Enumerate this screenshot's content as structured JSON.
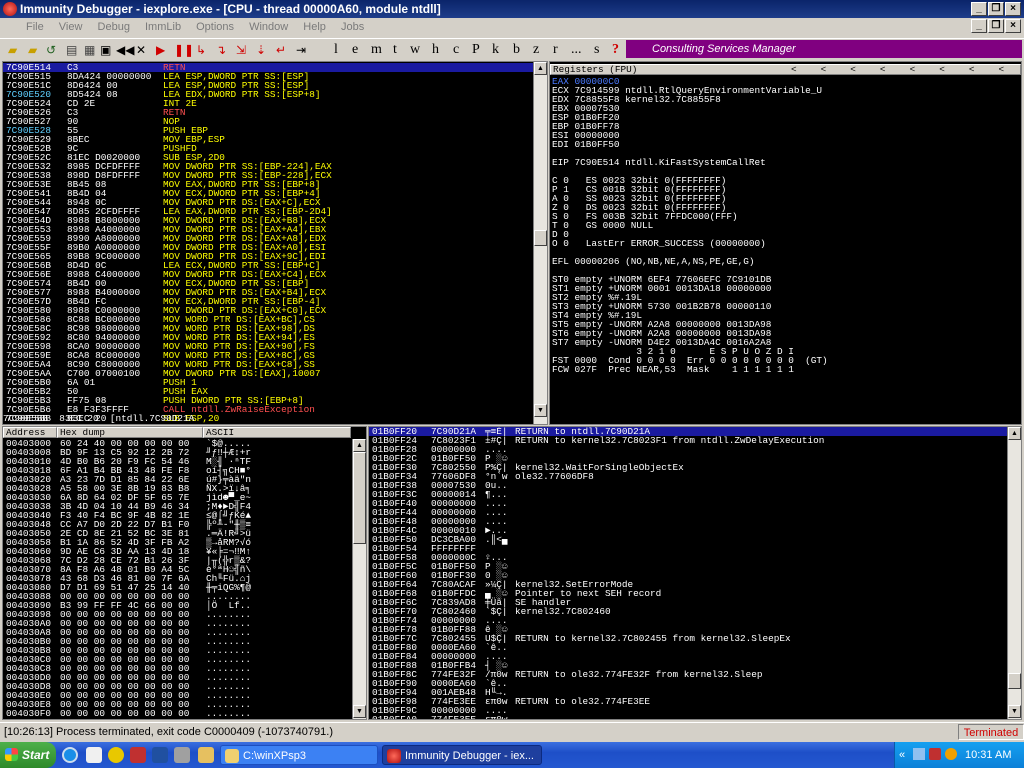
{
  "window": {
    "title": "Immunity Debugger - iexplore.exe - [CPU - thread 00000A60, module ntdll]"
  },
  "menu": [
    "File",
    "View",
    "Debug",
    "ImmLib",
    "Options",
    "Window",
    "Help",
    "Jobs"
  ],
  "toolbar": {
    "letters": [
      "l",
      "e",
      "m",
      "t",
      "w",
      "h",
      "c",
      "P",
      "k",
      "b",
      "z",
      "r",
      "...",
      "s",
      "?"
    ],
    "banner": "Consulting Services Manager"
  },
  "disasm": [
    {
      "a": "7C90E514",
      "h": "C3",
      "i": "RETN",
      "c": "#ff5050"
    },
    {
      "a": "7C90E515",
      "h": "8DA424 00000000",
      "i": "LEA ESP,DWORD PTR SS:[ESP]",
      "c": "#ffff00"
    },
    {
      "a": "7C90E51C",
      "h": "8D6424 00",
      "i": "LEA ESP,DWORD PTR SS:[ESP]",
      "c": "#ffff00"
    },
    {
      "a": "7C90E520",
      "h": "8D5424 08",
      "i": "LEA EDX,DWORD PTR SS:[ESP+8]",
      "c": "#ffff00"
    },
    {
      "a": "7C90E524",
      "h": "CD 2E",
      "i": "INT 2E",
      "c": "#ffff00"
    },
    {
      "a": "7C90E526",
      "h": "C3",
      "i": "RETN",
      "c": "#ff5050"
    },
    {
      "a": "7C90E527",
      "h": "90",
      "i": "NOP",
      "c": "#ffff00"
    },
    {
      "a": "7C90E528",
      "h": "55",
      "i": "PUSH EBP",
      "c": "#ffff00"
    },
    {
      "a": "7C90E529",
      "h": "8BEC",
      "i": "MOV EBP,ESP",
      "c": "#ffff00"
    },
    {
      "a": "7C90E52B",
      "h": "9C",
      "i": "PUSHFD",
      "c": "#ffff00"
    },
    {
      "a": "7C90E52C",
      "h": "81EC D0020000",
      "i": "SUB ESP,2D0",
      "c": "#ffff00"
    },
    {
      "a": "7C90E532",
      "h": "8985 DCFDFFFF",
      "i": "MOV DWORD PTR SS:[EBP-224],EAX",
      "c": "#ffff00"
    },
    {
      "a": "7C90E538",
      "h": "898D D8FDFFFF",
      "i": "MOV DWORD PTR SS:[EBP-228],ECX",
      "c": "#ffff00"
    },
    {
      "a": "7C90E53E",
      "h": "8B45 08",
      "i": "MOV EAX,DWORD PTR SS:[EBP+8]",
      "c": "#ffff00"
    },
    {
      "a": "7C90E541",
      "h": "8B4D 04",
      "i": "MOV ECX,DWORD PTR SS:[EBP+4]",
      "c": "#ffff00"
    },
    {
      "a": "7C90E544",
      "h": "8948 0C",
      "i": "MOV DWORD PTR DS:[EAX+C],ECX",
      "c": "#ffff00"
    },
    {
      "a": "7C90E547",
      "h": "8D85 2CFDFFFF",
      "i": "LEA EAX,DWORD PTR SS:[EBP-2D4]",
      "c": "#ffff00"
    },
    {
      "a": "7C90E54D",
      "h": "8988 B8000000",
      "i": "MOV DWORD PTR DS:[EAX+B8],ECX",
      "c": "#ffff00"
    },
    {
      "a": "7C90E553",
      "h": "8998 A4000000",
      "i": "MOV DWORD PTR DS:[EAX+A4],EBX",
      "c": "#ffff00"
    },
    {
      "a": "7C90E559",
      "h": "8990 A8000000",
      "i": "MOV DWORD PTR DS:[EAX+A8],EDX",
      "c": "#ffff00"
    },
    {
      "a": "7C90E55F",
      "h": "89B0 A0000000",
      "i": "MOV DWORD PTR DS:[EAX+A0],ESI",
      "c": "#ffff00"
    },
    {
      "a": "7C90E565",
      "h": "89B8 9C000000",
      "i": "MOV DWORD PTR DS:[EAX+9C],EDI",
      "c": "#ffff00"
    },
    {
      "a": "7C90E56B",
      "h": "8D4D 0C",
      "i": "LEA ECX,DWORD PTR SS:[EBP+C]",
      "c": "#ffff00"
    },
    {
      "a": "7C90E56E",
      "h": "8988 C4000000",
      "i": "MOV DWORD PTR DS:[EAX+C4],ECX",
      "c": "#ffff00"
    },
    {
      "a": "7C90E574",
      "h": "8B4D 00",
      "i": "MOV ECX,DWORD PTR SS:[EBP]",
      "c": "#ffff00"
    },
    {
      "a": "7C90E577",
      "h": "8988 B4000000",
      "i": "MOV DWORD PTR DS:[EAX+B4],ECX",
      "c": "#ffff00"
    },
    {
      "a": "7C90E57D",
      "h": "8B4D FC",
      "i": "MOV ECX,DWORD PTR SS:[EBP-4]",
      "c": "#ffff00"
    },
    {
      "a": "7C90E580",
      "h": "8988 C0000000",
      "i": "MOV DWORD PTR DS:[EAX+C0],ECX",
      "c": "#ffff00"
    },
    {
      "a": "7C90E586",
      "h": "8C88 BC000000",
      "i": "MOV WORD PTR DS:[EAX+BC],CS",
      "c": "#ffff00"
    },
    {
      "a": "7C90E58C",
      "h": "8C98 98000000",
      "i": "MOV WORD PTR DS:[EAX+98],DS",
      "c": "#ffff00"
    },
    {
      "a": "7C90E592",
      "h": "8C80 94000000",
      "i": "MOV WORD PTR DS:[EAX+94],ES",
      "c": "#ffff00"
    },
    {
      "a": "7C90E598",
      "h": "8CA0 90000000",
      "i": "MOV WORD PTR DS:[EAX+90],FS",
      "c": "#ffff00"
    },
    {
      "a": "7C90E59E",
      "h": "8CA8 8C000000",
      "i": "MOV WORD PTR DS:[EAX+8C],GS",
      "c": "#ffff00"
    },
    {
      "a": "7C90E5A4",
      "h": "8C90 C8000000",
      "i": "MOV WORD PTR DS:[EAX+C8],SS",
      "c": "#ffff00"
    },
    {
      "a": "7C90E5AA",
      "h": "C700 07000100",
      "i": "MOV DWORD PTR DS:[EAX],10007",
      "c": "#ffff00"
    },
    {
      "a": "7C90E5B0",
      "h": "6A 01",
      "i": "PUSH 1",
      "c": "#ffff00"
    },
    {
      "a": "7C90E5B2",
      "h": "50",
      "i": "PUSH EAX",
      "c": "#ffff00"
    },
    {
      "a": "7C90E5B3",
      "h": "FF75 08",
      "i": "PUSH DWORD PTR SS:[EBP+8]",
      "c": "#ffff00"
    },
    {
      "a": "7C90E5B6",
      "h": "E8 F3F3FFFF",
      "i": "CALL ntdll.ZwRaiseException",
      "c": "#ff5050"
    },
    {
      "a": "7C90E5BB",
      "h": "83EC 20",
      "i": "SUB ESP,20",
      "c": "#ffff00"
    }
  ],
  "info_line": "7C90E5BB  83EC 20  [ntdll.7C90D21A",
  "registers": {
    "header": "Registers (FPU)",
    "header_arrows": [
      "<",
      "<",
      "<",
      "<",
      "<",
      "<",
      "<",
      "<"
    ],
    "lines": [
      {
        "t": "EAX 000000C0",
        "c": "#4a7aff"
      },
      {
        "t": "ECX 7C914599 ntdll.RtlQueryEnvironmentVariable_U",
        "c": "#ffffff"
      },
      {
        "t": "EDX 7C8855F8 kernel32.7C8855F8",
        "c": "#ffffff"
      },
      {
        "t": "EBX 00007530",
        "c": "#ffffff"
      },
      {
        "t": "ESP 01B0FF20",
        "c": "#ffffff"
      },
      {
        "t": "EBP 01B0FF78",
        "c": "#ffffff"
      },
      {
        "t": "ESI 00000000",
        "c": "#ffffff"
      },
      {
        "t": "EDI 01B0FF50",
        "c": "#ffffff"
      },
      {
        "t": "",
        "c": "#ffffff"
      },
      {
        "t": "EIP 7C90E514 ntdll.KiFastSystemCallRet",
        "c": "#ffffff"
      },
      {
        "t": "",
        "c": "#ffffff"
      },
      {
        "t": "C 0   ES 0023 32bit 0(FFFFFFFF)",
        "c": "#ffffff"
      },
      {
        "t": "P 1   CS 001B 32bit 0(FFFFFFFF)",
        "c": "#ffffff"
      },
      {
        "t": "A 0   SS 0023 32bit 0(FFFFFFFF)",
        "c": "#ffffff"
      },
      {
        "t": "Z 0   DS 0023 32bit 0(FFFFFFFF)",
        "c": "#ffffff"
      },
      {
        "t": "S 0   FS 003B 32bit 7FFDC000(FFF)",
        "c": "#ffffff"
      },
      {
        "t": "T 0   GS 0000 NULL",
        "c": "#ffffff"
      },
      {
        "t": "D 0",
        "c": "#ffffff"
      },
      {
        "t": "O 0   LastErr ERROR_SUCCESS (00000000)",
        "c": "#ffffff"
      },
      {
        "t": "",
        "c": "#ffffff"
      },
      {
        "t": "EFL 00000206 (NO,NB,NE,A,NS,PE,GE,G)",
        "c": "#ffffff"
      },
      {
        "t": "",
        "c": "#ffffff"
      },
      {
        "t": "ST0 empty +UNORM 6EF4 77606EFC 7C9101DB",
        "c": "#ffffff"
      },
      {
        "t": "ST1 empty +UNORM 0001 0013DA18 00000000",
        "c": "#ffffff"
      },
      {
        "t": "ST2 empty %#.19L",
        "c": "#ffffff"
      },
      {
        "t": "ST3 empty +UNORM 5730 001B2B78 00000110",
        "c": "#ffffff"
      },
      {
        "t": "ST4 empty %#.19L",
        "c": "#ffffff"
      },
      {
        "t": "ST5 empty -UNORM A2A8 00000000 0013DA98",
        "c": "#ffffff"
      },
      {
        "t": "ST6 empty -UNORM A2A8 00000000 0013DA98",
        "c": "#ffffff"
      },
      {
        "t": "ST7 empty -UNORM D4E2 0013DA4C 0016A2A8",
        "c": "#ffffff"
      },
      {
        "t": "               3 2 1 0      E S P U O Z D I",
        "c": "#ffffff"
      },
      {
        "t": "FST 0000  Cond 0 0 0 0  Err 0 0 0 0 0 0 0 0  (GT)",
        "c": "#ffffff"
      },
      {
        "t": "FCW 027F  Prec NEAR,53  Mask    1 1 1 1 1 1",
        "c": "#ffffff"
      }
    ]
  },
  "hexdump": {
    "headers": [
      "Address",
      "Hex dump",
      "ASCII"
    ],
    "rows": [
      {
        "a": "00403000",
        "h": "60 24 40 00 00 00 00 00",
        "s": "`$@....."
      },
      {
        "a": "00403008",
        "h": "BD 9F 13 C5 92 12 2B 72",
        "s": "╜ƒ‼┼Æ↕+r"
      },
      {
        "a": "00403010",
        "h": "4D B0 B6 20 F9 FC 54 46",
        "s": "M░╢ ∙ⁿTF"
      },
      {
        "a": "00403018",
        "h": "6F A1 B4 BB 43 48 FE F8",
        "s": "oí┤╗CH■°"
      },
      {
        "a": "00403020",
        "h": "A3 23 7D D1 85 84 22 6E",
        "s": "ú#}╤àä\"n"
      },
      {
        "a": "00403028",
        "h": "A5 58 00 3E 8B 19 83 B8",
        "s": "ÑX.>ï↓â╕"
      },
      {
        "a": "00403030",
        "h": "6A 8D 64 02 DF 5F 65 7E",
        "s": "jìd☻▀_e~"
      },
      {
        "a": "00403038",
        "h": "3B 4D 04 10 44 B9 46 34",
        "s": ";M♦►D╣F4"
      },
      {
        "a": "00403040",
        "h": "F3 40 F4 BC 9F 4B 82 1E",
        "s": "≤@⌠╝ƒKé▲"
      },
      {
        "a": "00403048",
        "h": "CC A7 D0 2D 22 D7 B1 F0",
        "s": "╠º╨-\"╫▒≡"
      },
      {
        "a": "00403050",
        "h": "2E CD 8E 21 52 BC 3E 81",
        "s": ".═Ä!R╝>ü"
      },
      {
        "a": "00403058",
        "h": "B1 1A 86 52 4D 3F FB A2",
        "s": "▒→åRM?√ó"
      },
      {
        "a": "00403060",
        "h": "9D AE C6 3D AA 13 4D 18",
        "s": "¥«╞=¬‼M↑"
      },
      {
        "a": "00403068",
        "h": "7C D2 28 CE 72 B1 26 3F",
        "s": "|╥(╬r▒&?"
      },
      {
        "a": "00403070",
        "h": "8A F8 A6 48 01 B9 A4 5C",
        "s": "è°ªH☺╣ñ\\"
      },
      {
        "a": "00403078",
        "h": "43 68 D3 46 81 00 7F 6A",
        "s": "Ch╙Fü.⌂j"
      },
      {
        "a": "00403080",
        "h": "D7 D1 69 51 47 25 14 40",
        "s": "╫╤iQG%¶@"
      },
      {
        "a": "00403088",
        "h": "00 00 00 00 00 00 00 00",
        "s": "........"
      },
      {
        "a": "00403090",
        "h": "B3 99 FF FF 4C 66 00 00",
        "s": "│Ö  Lf.."
      },
      {
        "a": "00403098",
        "h": "00 00 00 00 00 00 00 00",
        "s": "........"
      },
      {
        "a": "004030A0",
        "h": "00 00 00 00 00 00 00 00",
        "s": "........"
      },
      {
        "a": "004030A8",
        "h": "00 00 00 00 00 00 00 00",
        "s": "........"
      },
      {
        "a": "004030B0",
        "h": "00 00 00 00 00 00 00 00",
        "s": "........"
      },
      {
        "a": "004030B8",
        "h": "00 00 00 00 00 00 00 00",
        "s": "........"
      },
      {
        "a": "004030C0",
        "h": "00 00 00 00 00 00 00 00",
        "s": "........"
      },
      {
        "a": "004030C8",
        "h": "00 00 00 00 00 00 00 00",
        "s": "........"
      },
      {
        "a": "004030D0",
        "h": "00 00 00 00 00 00 00 00",
        "s": "........"
      },
      {
        "a": "004030D8",
        "h": "00 00 00 00 00 00 00 00",
        "s": "........"
      },
      {
        "a": "004030E0",
        "h": "00 00 00 00 00 00 00 00",
        "s": "........"
      },
      {
        "a": "004030E8",
        "h": "00 00 00 00 00 00 00 00",
        "s": "........"
      },
      {
        "a": "004030F0",
        "h": "00 00 00 00 00 00 00 00",
        "s": "........"
      }
    ]
  },
  "stack": [
    {
      "a": "01B0FF20",
      "v": "7C90D21A",
      "s": "╤≡É|",
      "c": "RETURN to ntdll.7C90D21A"
    },
    {
      "a": "01B0FF24",
      "v": "7C8023F1",
      "s": "±#Ç|",
      "c": "RETURN to kernel32.7C8023F1 from ntdll.ZwDelayExecution"
    },
    {
      "a": "01B0FF28",
      "v": "00000000",
      "s": "....",
      "c": ""
    },
    {
      "a": "01B0FF2C",
      "v": "01B0FF50",
      "s": "P ░☺",
      "c": ""
    },
    {
      "a": "01B0FF30",
      "v": "7C802550",
      "s": "P%Ç|",
      "c": "kernel32.WaitForSingleObjectEx"
    },
    {
      "a": "01B0FF34",
      "v": "77606DF8",
      "s": "°n`w",
      "c": "ole32.77606DF8"
    },
    {
      "a": "01B0FF38",
      "v": "00007530",
      "s": "0u..",
      "c": ""
    },
    {
      "a": "01B0FF3C",
      "v": "00000014",
      "s": "¶...",
      "c": ""
    },
    {
      "a": "01B0FF40",
      "v": "00000000",
      "s": "....",
      "c": ""
    },
    {
      "a": "01B0FF44",
      "v": "00000000",
      "s": "....",
      "c": ""
    },
    {
      "a": "01B0FF48",
      "v": "00000000",
      "s": "....",
      "c": ""
    },
    {
      "a": "01B0FF4C",
      "v": "00000010",
      "s": "►...",
      "c": ""
    },
    {
      "a": "01B0FF50",
      "v": "DC3CBA00",
      "s": ".║<▄",
      "c": ""
    },
    {
      "a": "01B0FF54",
      "v": "FFFFFFFF",
      "s": "    ",
      "c": ""
    },
    {
      "a": "01B0FF58",
      "v": "0000000C",
      "s": "♀...",
      "c": ""
    },
    {
      "a": "01B0FF5C",
      "v": "01B0FF50",
      "s": "P ░☺",
      "c": ""
    },
    {
      "a": "01B0FF60",
      "v": "01B0FF30",
      "s": "0 ░☺",
      "c": ""
    },
    {
      "a": "01B0FF64",
      "v": "7C80ACAF",
      "s": "»¼Ç|",
      "c": "kernel32.SetErrorMode"
    },
    {
      "a": "01B0FF68",
      "v": "01B0FFDC",
      "s": "▄ ░☺",
      "c": "Pointer to next SEH record"
    },
    {
      "a": "01B0FF6C",
      "v": "7C839AD8",
      "s": "╪Üâ|",
      "c": "SE handler"
    },
    {
      "a": "01B0FF70",
      "v": "7C802460",
      "s": "`$Ç|",
      "c": "kernel32.7C802460"
    },
    {
      "a": "01B0FF74",
      "v": "00000000",
      "s": "....",
      "c": ""
    },
    {
      "a": "01B0FF78",
      "v": "01B0FF88",
      "s": "ê ░☺",
      "c": ""
    },
    {
      "a": "01B0FF7C",
      "v": "7C802455",
      "s": "U$Ç|",
      "c": "RETURN to kernel32.7C802455 from kernel32.SleepEx"
    },
    {
      "a": "01B0FF80",
      "v": "0000EA60",
      "s": "`ê..",
      "c": ""
    },
    {
      "a": "01B0FF84",
      "v": "00000000",
      "s": "....",
      "c": ""
    },
    {
      "a": "01B0FF88",
      "v": "01B0FFB4",
      "s": "┤ ░☺",
      "c": ""
    },
    {
      "a": "01B0FF8C",
      "v": "774FE32F",
      "s": "/π0w",
      "c": "RETURN to ole32.774FE32F from kernel32.Sleep"
    },
    {
      "a": "01B0FF90",
      "v": "0000EA60",
      "s": "`ê..",
      "c": ""
    },
    {
      "a": "01B0FF94",
      "v": "001AEB48",
      "s": "H╙→.",
      "c": ""
    },
    {
      "a": "01B0FF98",
      "v": "774FE3EE",
      "s": "επ0w",
      "c": "RETURN to ole32.774FE3EE"
    },
    {
      "a": "01B0FF9C",
      "v": "00000000",
      "s": "....",
      "c": ""
    },
    {
      "a": "01B0FFA0",
      "v": "774FE3EE",
      "s": "επ0w",
      "c": ""
    }
  ],
  "status": {
    "message": "[10:26:13] Process terminated, exit code C0000409 (-1073740791.)",
    "state": "Terminated"
  },
  "taskbar": {
    "start": "Start",
    "tasks": [
      "C:\\winXPsp3",
      "Immunity Debugger - iex..."
    ],
    "clock": "10:31 AM"
  },
  "colors": {
    "addr": "#ffffff",
    "hex": "#ffffff",
    "sel": "#1a1aa0",
    "banner": "#800080"
  }
}
